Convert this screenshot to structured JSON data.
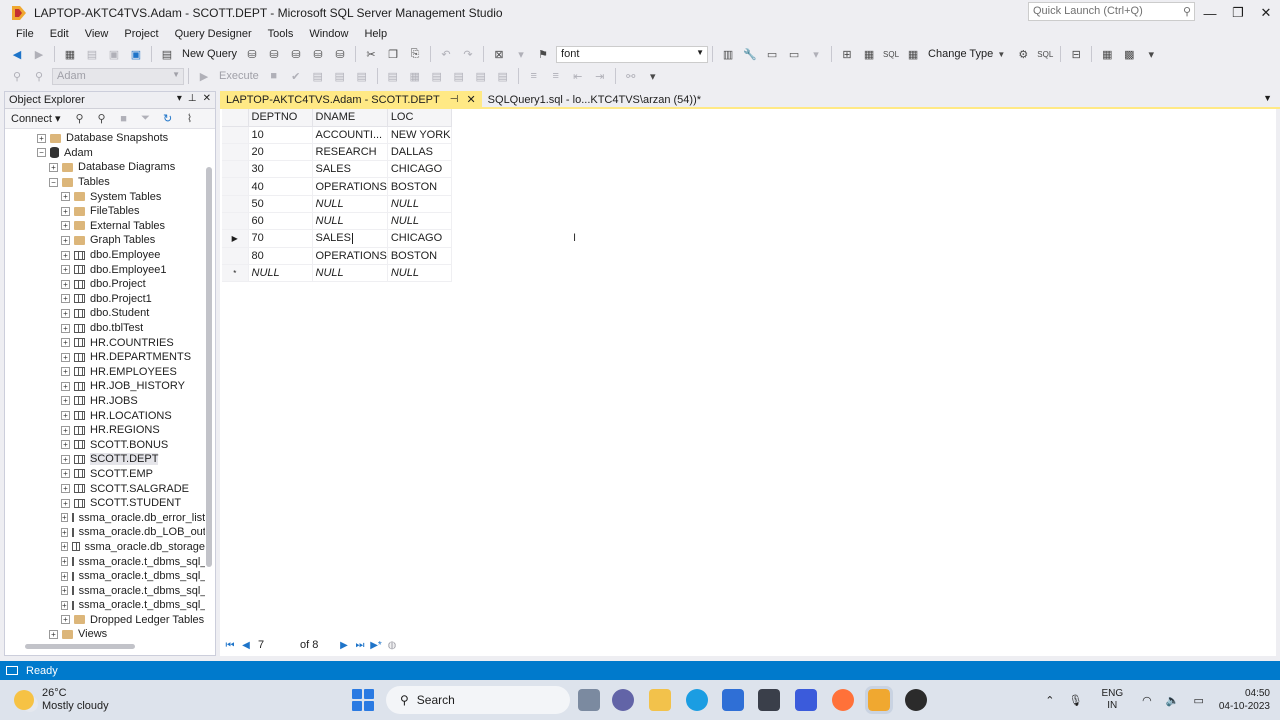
{
  "window": {
    "title": "LAPTOP-AKTC4TVS.Adam - SCOTT.DEPT - Microsoft SQL Server Management Studio",
    "quick_launch_placeholder": "Quick Launch (Ctrl+Q)",
    "minimize": "—",
    "restore": "❐",
    "close": "✕"
  },
  "menu": [
    "File",
    "Edit",
    "View",
    "Project",
    "Query Designer",
    "Tools",
    "Window",
    "Help"
  ],
  "toolbar": {
    "new_query": "New Query",
    "font_value": "font",
    "change_type": "Change Type",
    "execute": "Execute",
    "database": "Adam"
  },
  "object_explorer": {
    "title": "Object Explorer",
    "connect": "Connect",
    "nodes": [
      {
        "label": "Database Snapshots",
        "depth": 2,
        "expander": "+",
        "icon": "folder"
      },
      {
        "label": "Adam",
        "depth": 2,
        "expander": "−",
        "icon": "database"
      },
      {
        "label": "Database Diagrams",
        "depth": 3,
        "expander": "+",
        "icon": "folder"
      },
      {
        "label": "Tables",
        "depth": 3,
        "expander": "−",
        "icon": "folder"
      },
      {
        "label": "System Tables",
        "depth": 4,
        "expander": "+",
        "icon": "folder"
      },
      {
        "label": "FileTables",
        "depth": 4,
        "expander": "+",
        "icon": "folder"
      },
      {
        "label": "External Tables",
        "depth": 4,
        "expander": "+",
        "icon": "folder"
      },
      {
        "label": "Graph Tables",
        "depth": 4,
        "expander": "+",
        "icon": "folder"
      },
      {
        "label": "dbo.Employee",
        "depth": 4,
        "expander": "+",
        "icon": "table"
      },
      {
        "label": "dbo.Employee1",
        "depth": 4,
        "expander": "+",
        "icon": "table"
      },
      {
        "label": "dbo.Project",
        "depth": 4,
        "expander": "+",
        "icon": "table"
      },
      {
        "label": "dbo.Project1",
        "depth": 4,
        "expander": "+",
        "icon": "table"
      },
      {
        "label": "dbo.Student",
        "depth": 4,
        "expander": "+",
        "icon": "table"
      },
      {
        "label": "dbo.tblTest",
        "depth": 4,
        "expander": "+",
        "icon": "table"
      },
      {
        "label": "HR.COUNTRIES",
        "depth": 4,
        "expander": "+",
        "icon": "table"
      },
      {
        "label": "HR.DEPARTMENTS",
        "depth": 4,
        "expander": "+",
        "icon": "table"
      },
      {
        "label": "HR.EMPLOYEES",
        "depth": 4,
        "expander": "+",
        "icon": "table"
      },
      {
        "label": "HR.JOB_HISTORY",
        "depth": 4,
        "expander": "+",
        "icon": "table"
      },
      {
        "label": "HR.JOBS",
        "depth": 4,
        "expander": "+",
        "icon": "table"
      },
      {
        "label": "HR.LOCATIONS",
        "depth": 4,
        "expander": "+",
        "icon": "table"
      },
      {
        "label": "HR.REGIONS",
        "depth": 4,
        "expander": "+",
        "icon": "table"
      },
      {
        "label": "SCOTT.BONUS",
        "depth": 4,
        "expander": "+",
        "icon": "table"
      },
      {
        "label": "SCOTT.DEPT",
        "depth": 4,
        "expander": "+",
        "icon": "table",
        "selected": true
      },
      {
        "label": "SCOTT.EMP",
        "depth": 4,
        "expander": "+",
        "icon": "table"
      },
      {
        "label": "SCOTT.SALGRADE",
        "depth": 4,
        "expander": "+",
        "icon": "table"
      },
      {
        "label": "SCOTT.STUDENT",
        "depth": 4,
        "expander": "+",
        "icon": "table"
      },
      {
        "label": "ssma_oracle.db_error_list",
        "depth": 4,
        "expander": "+",
        "icon": "table"
      },
      {
        "label": "ssma_oracle.db_LOB_outp",
        "depth": 4,
        "expander": "+",
        "icon": "table"
      },
      {
        "label": "ssma_oracle.db_storage",
        "depth": 4,
        "expander": "+",
        "icon": "table"
      },
      {
        "label": "ssma_oracle.t_dbms_sql_b",
        "depth": 4,
        "expander": "+",
        "icon": "table"
      },
      {
        "label": "ssma_oracle.t_dbms_sql_c",
        "depth": 4,
        "expander": "+",
        "icon": "table"
      },
      {
        "label": "ssma_oracle.t_dbms_sql_d",
        "depth": 4,
        "expander": "+",
        "icon": "table"
      },
      {
        "label": "ssma_oracle.t_dbms_sql_re",
        "depth": 4,
        "expander": "+",
        "icon": "table"
      },
      {
        "label": "Dropped Ledger Tables",
        "depth": 4,
        "expander": "+",
        "icon": "folder"
      },
      {
        "label": "Views",
        "depth": 3,
        "expander": "+",
        "icon": "folder"
      }
    ]
  },
  "tabs": [
    {
      "label": "LAPTOP-AKTC4TVS.Adam - SCOTT.DEPT",
      "active": true
    },
    {
      "label": "SQLQuery1.sql - lo...KTC4TVS\\arzan (54))*",
      "active": false
    }
  ],
  "grid": {
    "columns": [
      "DEPTNO",
      "DNAME",
      "LOC"
    ],
    "rows": [
      {
        "marker": "",
        "cells": [
          "10",
          "ACCOUNTI...",
          "NEW YORK"
        ]
      },
      {
        "marker": "",
        "cells": [
          "20",
          "RESEARCH",
          "DALLAS"
        ]
      },
      {
        "marker": "",
        "cells": [
          "30",
          "SALES",
          "CHICAGO"
        ]
      },
      {
        "marker": "",
        "cells": [
          "40",
          "OPERATIONS",
          "BOSTON"
        ]
      },
      {
        "marker": "",
        "cells": [
          "50",
          "NULL",
          "NULL"
        ]
      },
      {
        "marker": "",
        "cells": [
          "60",
          "NULL",
          "NULL"
        ]
      },
      {
        "marker": "▶",
        "cells": [
          "70",
          "SALES",
          "CHICAGO"
        ],
        "editing": true
      },
      {
        "marker": "",
        "cells": [
          "80",
          "OPERATIONS",
          "BOSTON"
        ]
      },
      {
        "marker": "*",
        "cells": [
          "NULL",
          "NULL",
          "NULL"
        ]
      }
    ]
  },
  "navigation": {
    "current_row": "7",
    "of_label": "of 8"
  },
  "status": {
    "text": "Ready",
    "accent": "#007acc"
  },
  "taskbar": {
    "weather_temp": "26°C",
    "weather_desc": "Mostly cloudy",
    "search": "Search",
    "lang_top": "ENG",
    "lang_bottom": "IN",
    "time": "04:50",
    "date": "04-10-2023"
  }
}
